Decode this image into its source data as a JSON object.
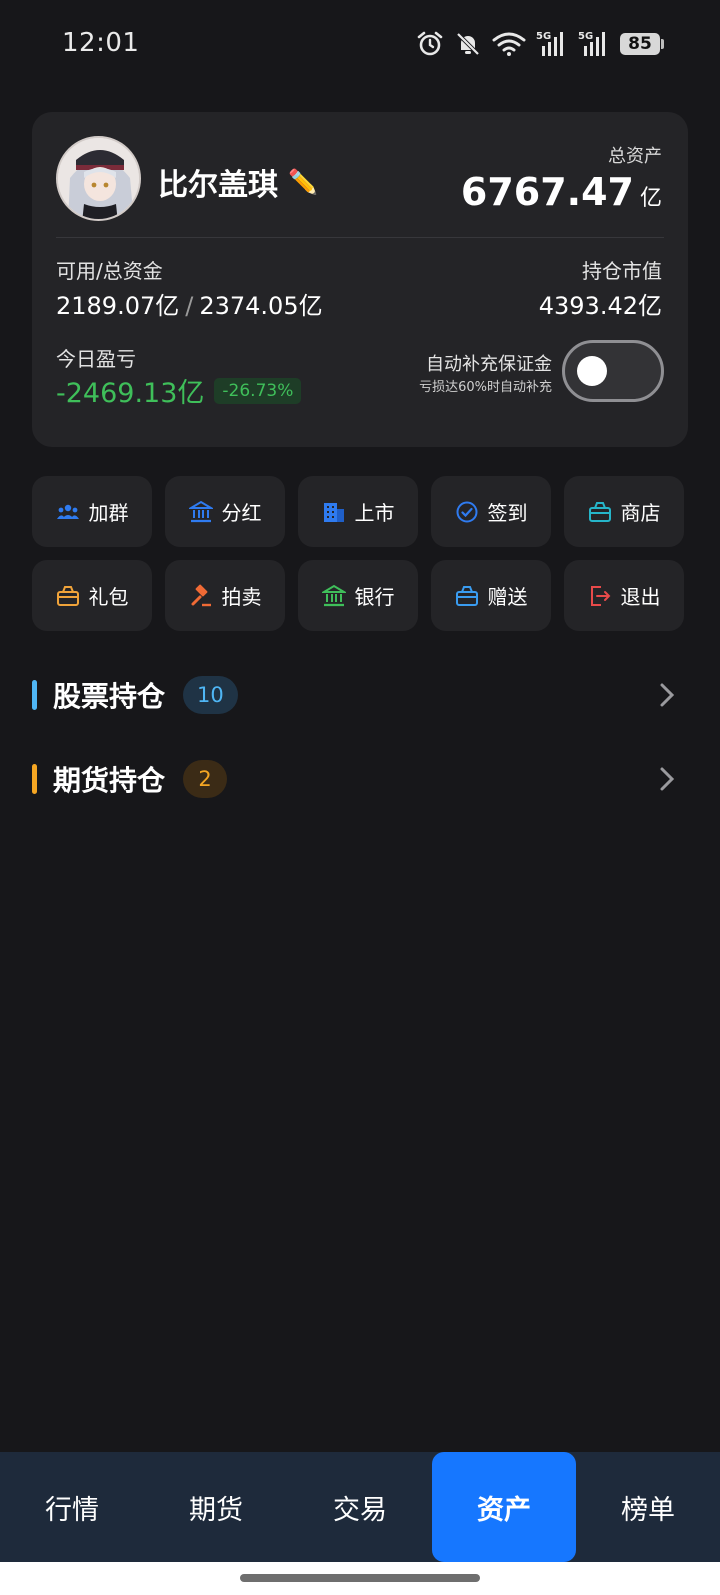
{
  "status_bar": {
    "time": "12:01",
    "battery": "85",
    "icons": [
      "alarm-icon",
      "bell-muted-icon",
      "wifi-icon",
      "signal-5g-icon",
      "signal-5g-icon",
      "battery-icon"
    ]
  },
  "profile": {
    "name": "比尔盖琪",
    "edit_icon": "✏️",
    "total_assets_label": "总资产",
    "total_assets_value": "6767.47",
    "total_assets_unit": "亿",
    "available_label": "可用/总资金",
    "available_value": "2189.07亿",
    "separator": "/",
    "total_funds_value": "2374.05亿",
    "position_value_label": "持仓市值",
    "position_value": "4393.42亿",
    "today_pnl_label": "今日盈亏",
    "today_pnl_value": "-2469.13亿",
    "today_pnl_percent": "-26.73%",
    "auto_margin_title": "自动补充保证金",
    "auto_margin_subtitle": "亏损达60%时自动补充",
    "auto_margin_enabled": false
  },
  "actions": [
    {
      "label": "加群",
      "icon": "group-icon",
      "color": "#2f7bf0"
    },
    {
      "label": "分红",
      "icon": "bank-icon",
      "color": "#2f7bf0"
    },
    {
      "label": "上市",
      "icon": "building-icon",
      "color": "#2f7bf0"
    },
    {
      "label": "签到",
      "icon": "check-circle-icon",
      "color": "#2f7bf0"
    },
    {
      "label": "商店",
      "icon": "shop-icon",
      "color": "#26b5c9"
    },
    {
      "label": "礼包",
      "icon": "gift-box-icon",
      "color": "#f0a33a"
    },
    {
      "label": "拍卖",
      "icon": "gavel-icon",
      "color": "#f06a35"
    },
    {
      "label": "银行",
      "icon": "bank-icon",
      "color": "#3fbf5a"
    },
    {
      "label": "赠送",
      "icon": "gift-icon",
      "color": "#3a9cf0"
    },
    {
      "label": "退出",
      "icon": "logout-icon",
      "color": "#e84a4a"
    }
  ],
  "holdings": [
    {
      "title": "股票持仓",
      "count": "10",
      "accent": "#4fb6f5"
    },
    {
      "title": "期货持仓",
      "count": "2",
      "accent": "#f5a623"
    }
  ],
  "bottom_nav": {
    "items": [
      "行情",
      "期货",
      "交易",
      "资产",
      "榜单"
    ],
    "active": "资产"
  }
}
